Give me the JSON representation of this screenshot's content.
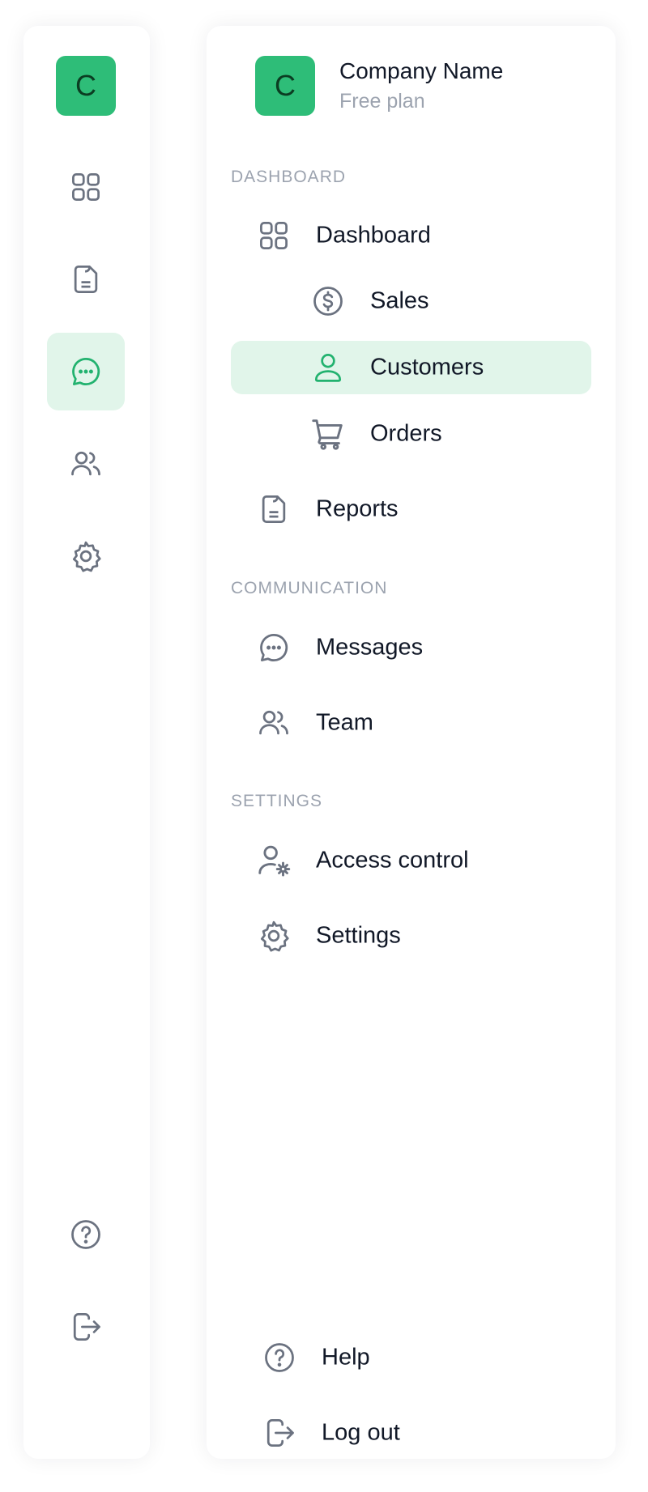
{
  "colors": {
    "accent": "#2ebd78",
    "active_bg": "#e1f5ea",
    "active_icon": "#22b26f",
    "icon": "#6b7280",
    "section_label": "#9ca3af"
  },
  "brand": {
    "logo_letter": "C",
    "company_name": "Company Name",
    "plan": "Free plan"
  },
  "rail": {
    "items": [
      {
        "icon": "grid-icon"
      },
      {
        "icon": "report-icon"
      },
      {
        "icon": "chat-icon",
        "active": true
      },
      {
        "icon": "users-icon"
      },
      {
        "icon": "gear-icon"
      },
      {
        "icon": "help-icon"
      },
      {
        "icon": "logout-icon"
      }
    ]
  },
  "nav": {
    "sections": {
      "dashboard": "DASHBOARD",
      "communication": "COMMUNICATION",
      "settings": "SETTINGS"
    },
    "dashboard": "Dashboard",
    "sales": "Sales",
    "customers": "Customers",
    "orders": "Orders",
    "reports": "Reports",
    "messages": "Messages",
    "team": "Team",
    "access_control": "Access control",
    "settings": "Settings",
    "help": "Help",
    "logout": "Log out",
    "active_item": "Customers"
  }
}
